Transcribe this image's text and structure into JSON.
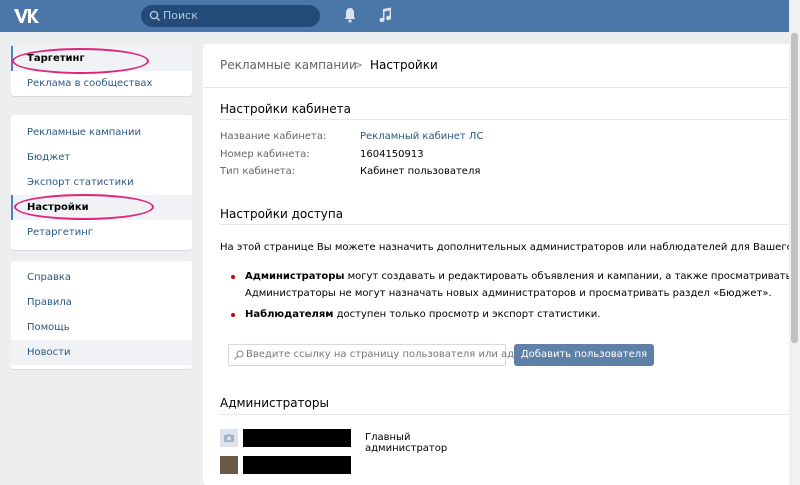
{
  "header": {
    "logo": "vk-logo",
    "search_placeholder": "Поиск",
    "accent": "#4a76a8"
  },
  "sidebar": {
    "group1": [
      {
        "label": "Таргетинг",
        "active": true
      },
      {
        "label": "Реклама в сообществах"
      }
    ],
    "group2": [
      {
        "label": "Рекламные кампании"
      },
      {
        "label": "Бюджет"
      },
      {
        "label": "Экспорт статистики"
      },
      {
        "label": "Настройки",
        "active": true
      },
      {
        "label": "Ретаргетинг"
      }
    ],
    "group3": [
      {
        "label": "Справка"
      },
      {
        "label": "Правила"
      },
      {
        "label": "Помощь"
      },
      {
        "label": "Новости"
      }
    ]
  },
  "breadcrumb": {
    "parent": "Рекламные кампании",
    "separator": ">",
    "current": "Настройки"
  },
  "cabinet": {
    "title": "Настройки кабинета",
    "rows": [
      {
        "label": "Название кабинета:",
        "value": "Рекламный кабинет ЛС"
      },
      {
        "label": "Номер кабинета:",
        "value": "1604150913"
      },
      {
        "label": "Тип кабинета:",
        "value": "Кабинет пользователя"
      }
    ]
  },
  "access": {
    "title": "Настройки доступа",
    "description": "На этой странице Вы можете назначить дополнительных администраторов или наблюдателей для Вашего личного ка",
    "bullet1_bold": "Администраторы",
    "bullet1_line1": " могут создавать и редактировать объявления и кампании, а также просматривать статистику.",
    "bullet1_line2": "Администраторы не могут назначать новых администраторов и просматривать раздел «Бюджет».",
    "bullet2_bold": "Наблюдателям",
    "bullet2_text": " доступен только просмотр и экспорт статистики.",
    "input_placeholder": "Введите ссылку на страницу пользователя или адрес...",
    "add_button": "Добавить пользователя"
  },
  "admins": {
    "title": "Администраторы",
    "rows": [
      {
        "role": "Главный администратор"
      },
      {
        "role": ""
      }
    ]
  }
}
